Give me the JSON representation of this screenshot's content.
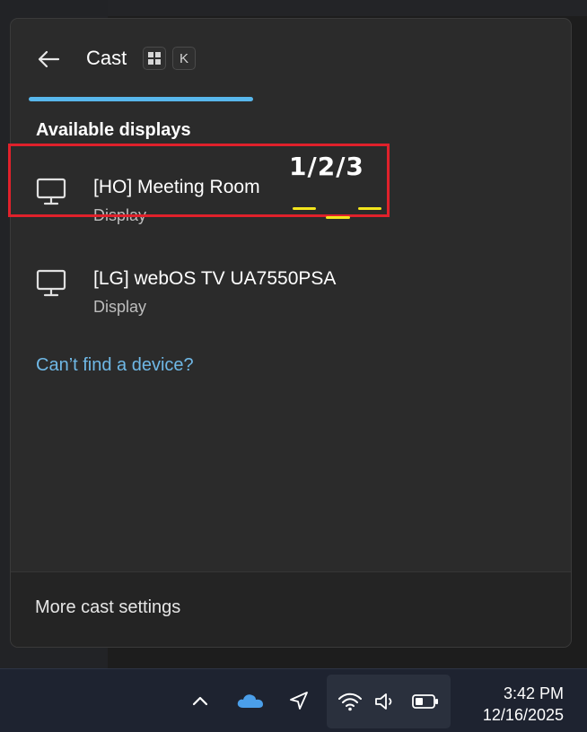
{
  "flyout": {
    "title": "Cast",
    "shortcut_keys": [
      "⊞",
      "K"
    ],
    "section_title": "Available displays",
    "devices": [
      {
        "name": "[HO] Meeting Room",
        "type": "Display",
        "icon": "monitor-icon"
      },
      {
        "name": "[LG] webOS TV UA7550PSA",
        "type": "Display",
        "icon": "monitor-icon"
      }
    ],
    "find_link": "Can’t find a device?",
    "footer_link": "More cast settings"
  },
  "annotation": {
    "text": "1/2/3",
    "box_color": "#e0212b",
    "underline_color": "#f3e51c"
  },
  "taskbar": {
    "icons": [
      "chevron-up-icon",
      "onedrive-cloud-icon",
      "location-arrow-icon",
      "wifi-icon",
      "volume-icon",
      "battery-icon"
    ],
    "time": "3:42 PM",
    "date": "12/16/2025"
  },
  "colors": {
    "accent": "#58b7ec",
    "link": "#6fb8e6",
    "flyout_bg": "#2b2b2b"
  }
}
